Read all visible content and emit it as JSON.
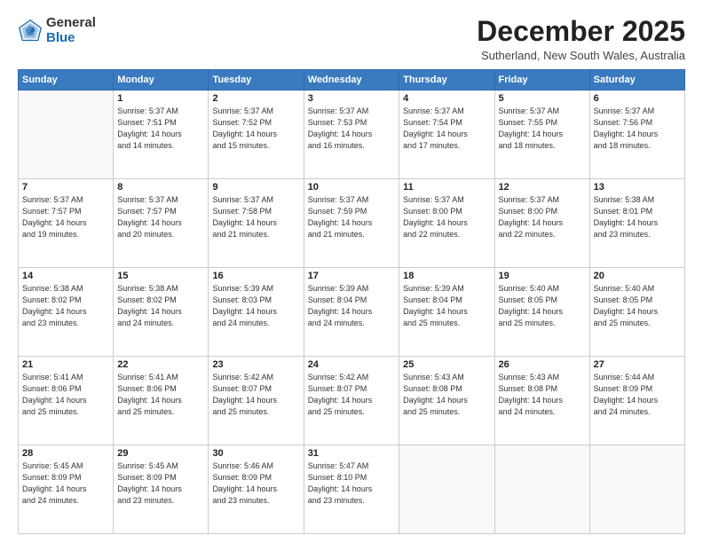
{
  "logo": {
    "general": "General",
    "blue": "Blue"
  },
  "header": {
    "month": "December 2025",
    "location": "Sutherland, New South Wales, Australia"
  },
  "weekdays": [
    "Sunday",
    "Monday",
    "Tuesday",
    "Wednesday",
    "Thursday",
    "Friday",
    "Saturday"
  ],
  "weeks": [
    [
      {
        "day": "",
        "info": ""
      },
      {
        "day": "1",
        "info": "Sunrise: 5:37 AM\nSunset: 7:51 PM\nDaylight: 14 hours\nand 14 minutes."
      },
      {
        "day": "2",
        "info": "Sunrise: 5:37 AM\nSunset: 7:52 PM\nDaylight: 14 hours\nand 15 minutes."
      },
      {
        "day": "3",
        "info": "Sunrise: 5:37 AM\nSunset: 7:53 PM\nDaylight: 14 hours\nand 16 minutes."
      },
      {
        "day": "4",
        "info": "Sunrise: 5:37 AM\nSunset: 7:54 PM\nDaylight: 14 hours\nand 17 minutes."
      },
      {
        "day": "5",
        "info": "Sunrise: 5:37 AM\nSunset: 7:55 PM\nDaylight: 14 hours\nand 18 minutes."
      },
      {
        "day": "6",
        "info": "Sunrise: 5:37 AM\nSunset: 7:56 PM\nDaylight: 14 hours\nand 18 minutes."
      }
    ],
    [
      {
        "day": "7",
        "info": "Sunrise: 5:37 AM\nSunset: 7:57 PM\nDaylight: 14 hours\nand 19 minutes."
      },
      {
        "day": "8",
        "info": "Sunrise: 5:37 AM\nSunset: 7:57 PM\nDaylight: 14 hours\nand 20 minutes."
      },
      {
        "day": "9",
        "info": "Sunrise: 5:37 AM\nSunset: 7:58 PM\nDaylight: 14 hours\nand 21 minutes."
      },
      {
        "day": "10",
        "info": "Sunrise: 5:37 AM\nSunset: 7:59 PM\nDaylight: 14 hours\nand 21 minutes."
      },
      {
        "day": "11",
        "info": "Sunrise: 5:37 AM\nSunset: 8:00 PM\nDaylight: 14 hours\nand 22 minutes."
      },
      {
        "day": "12",
        "info": "Sunrise: 5:37 AM\nSunset: 8:00 PM\nDaylight: 14 hours\nand 22 minutes."
      },
      {
        "day": "13",
        "info": "Sunrise: 5:38 AM\nSunset: 8:01 PM\nDaylight: 14 hours\nand 23 minutes."
      }
    ],
    [
      {
        "day": "14",
        "info": "Sunrise: 5:38 AM\nSunset: 8:02 PM\nDaylight: 14 hours\nand 23 minutes."
      },
      {
        "day": "15",
        "info": "Sunrise: 5:38 AM\nSunset: 8:02 PM\nDaylight: 14 hours\nand 24 minutes."
      },
      {
        "day": "16",
        "info": "Sunrise: 5:39 AM\nSunset: 8:03 PM\nDaylight: 14 hours\nand 24 minutes."
      },
      {
        "day": "17",
        "info": "Sunrise: 5:39 AM\nSunset: 8:04 PM\nDaylight: 14 hours\nand 24 minutes."
      },
      {
        "day": "18",
        "info": "Sunrise: 5:39 AM\nSunset: 8:04 PM\nDaylight: 14 hours\nand 25 minutes."
      },
      {
        "day": "19",
        "info": "Sunrise: 5:40 AM\nSunset: 8:05 PM\nDaylight: 14 hours\nand 25 minutes."
      },
      {
        "day": "20",
        "info": "Sunrise: 5:40 AM\nSunset: 8:05 PM\nDaylight: 14 hours\nand 25 minutes."
      }
    ],
    [
      {
        "day": "21",
        "info": "Sunrise: 5:41 AM\nSunset: 8:06 PM\nDaylight: 14 hours\nand 25 minutes."
      },
      {
        "day": "22",
        "info": "Sunrise: 5:41 AM\nSunset: 8:06 PM\nDaylight: 14 hours\nand 25 minutes."
      },
      {
        "day": "23",
        "info": "Sunrise: 5:42 AM\nSunset: 8:07 PM\nDaylight: 14 hours\nand 25 minutes."
      },
      {
        "day": "24",
        "info": "Sunrise: 5:42 AM\nSunset: 8:07 PM\nDaylight: 14 hours\nand 25 minutes."
      },
      {
        "day": "25",
        "info": "Sunrise: 5:43 AM\nSunset: 8:08 PM\nDaylight: 14 hours\nand 25 minutes."
      },
      {
        "day": "26",
        "info": "Sunrise: 5:43 AM\nSunset: 8:08 PM\nDaylight: 14 hours\nand 24 minutes."
      },
      {
        "day": "27",
        "info": "Sunrise: 5:44 AM\nSunset: 8:09 PM\nDaylight: 14 hours\nand 24 minutes."
      }
    ],
    [
      {
        "day": "28",
        "info": "Sunrise: 5:45 AM\nSunset: 8:09 PM\nDaylight: 14 hours\nand 24 minutes."
      },
      {
        "day": "29",
        "info": "Sunrise: 5:45 AM\nSunset: 8:09 PM\nDaylight: 14 hours\nand 23 minutes."
      },
      {
        "day": "30",
        "info": "Sunrise: 5:46 AM\nSunset: 8:09 PM\nDaylight: 14 hours\nand 23 minutes."
      },
      {
        "day": "31",
        "info": "Sunrise: 5:47 AM\nSunset: 8:10 PM\nDaylight: 14 hours\nand 23 minutes."
      },
      {
        "day": "",
        "info": ""
      },
      {
        "day": "",
        "info": ""
      },
      {
        "day": "",
        "info": ""
      }
    ]
  ]
}
